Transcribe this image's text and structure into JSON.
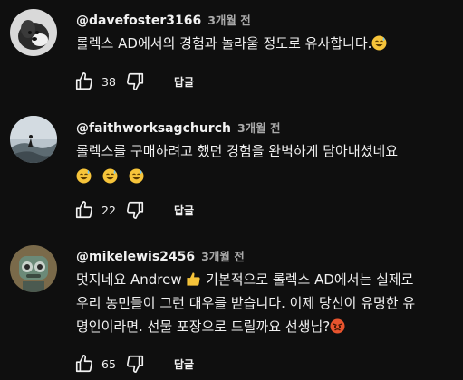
{
  "comments": [
    {
      "handle": "@davefoster3166",
      "time": "3개월 전",
      "lines": [
        "롤렉스 AD에서의 경험과 놀라울 정도로 유사합니다."
      ],
      "likes": "38",
      "reply_label": "답글",
      "avatar_icon": "dog-photo-avatar"
    },
    {
      "handle": "@faithworksagchurch",
      "time": "3개월 전",
      "lines": [
        "롤렉스를 구매하려고 했던 경험을 완벽하게 담아내셨네요"
      ],
      "likes": "22",
      "reply_label": "답글",
      "avatar_icon": "landscape-silhouette-avatar"
    },
    {
      "handle": "@mikelewis2456",
      "time": "3개월 전",
      "lines": [
        "멋지네요 Andrew",
        "기본적으로 롤렉스 AD에서는 실제로",
        "우리 농민들이 그런 대우를 받습니다. 이제 당신이 유명한 유",
        "명인이라면. 선물 포장으로 드릴까요 선생님?"
      ],
      "likes": "65",
      "reply_label": "답글",
      "avatar_icon": "robot-photo-avatar"
    }
  ],
  "colors": {
    "background": "#0f0f0f",
    "text": "#f1f1f1",
    "secondary_text": "#aaaaaa",
    "emoji_yellow": "#f6c43a",
    "emoji_angry": "#e8542e"
  }
}
